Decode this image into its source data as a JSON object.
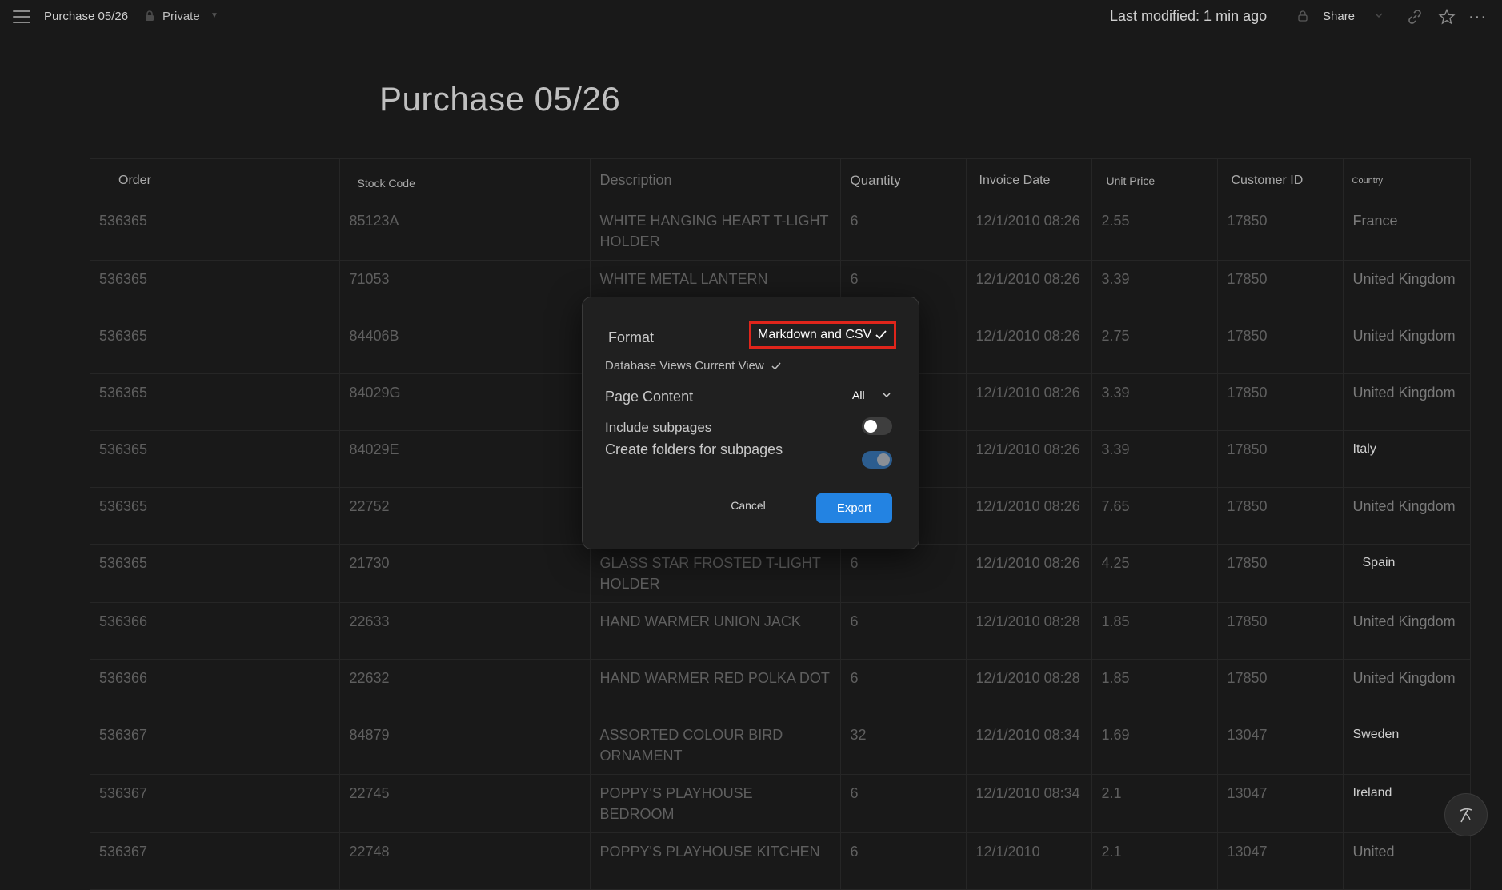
{
  "topbar": {
    "breadcrumb": "Purchase 05/26",
    "privacy": "Private",
    "last_modified": "Last modified: 1 min ago",
    "share_label": "Share"
  },
  "page": {
    "title": "Purchase 05/26"
  },
  "table": {
    "columns": [
      "Order",
      "Stock Code",
      "Description",
      "Quantity",
      "Invoice Date",
      "Unit Price",
      "Customer ID",
      "Country"
    ],
    "rows": [
      [
        "536365",
        "85123A",
        "WHITE HANGING HEART T-LIGHT HOLDER",
        "6",
        "12/1/2010 08:26",
        "2.55",
        "17850",
        "France"
      ],
      [
        "536365",
        "71053",
        "WHITE METAL LANTERN",
        "6",
        "12/1/2010 08:26",
        "3.39",
        "17850",
        "United Kingdom"
      ],
      [
        "536365",
        "84406B",
        "",
        "",
        "12/1/2010 08:26",
        "2.75",
        "17850",
        "United Kingdom"
      ],
      [
        "536365",
        "84029G",
        "",
        "",
        "12/1/2010 08:26",
        "3.39",
        "17850",
        "United Kingdom"
      ],
      [
        "536365",
        "84029E",
        "",
        "",
        "12/1/2010 08:26",
        "3.39",
        "17850",
        "Italy"
      ],
      [
        "536365",
        "22752",
        "",
        "",
        "12/1/2010 08:26",
        "7.65",
        "17850",
        "United Kingdom"
      ],
      [
        "536365",
        "21730",
        "GLASS STAR FROSTED T-LIGHT HOLDER",
        "6",
        "12/1/2010 08:26",
        "4.25",
        "17850",
        "Spain"
      ],
      [
        "536366",
        "22633",
        "HAND WARMER UNION JACK",
        "6",
        "12/1/2010 08:28",
        "1.85",
        "17850",
        "United Kingdom"
      ],
      [
        "536366",
        "22632",
        "HAND WARMER RED POLKA DOT",
        "6",
        "12/1/2010 08:28",
        "1.85",
        "17850",
        "United Kingdom"
      ],
      [
        "536367",
        "84879",
        "ASSORTED COLOUR BIRD ORNAMENT",
        "32",
        "12/1/2010 08:34",
        "1.69",
        "13047",
        "Sweden"
      ],
      [
        "536367",
        "22745",
        "POPPY'S PLAYHOUSE BEDROOM",
        "6",
        "12/1/2010 08:34",
        "2.1",
        "13047",
        "Ireland"
      ],
      [
        "536367",
        "22748",
        "POPPY'S PLAYHOUSE KITCHEN",
        "6",
        "12/1/2010",
        "2.1",
        "13047",
        "United"
      ]
    ],
    "bright_country_rows": [
      4,
      6,
      9,
      10
    ]
  },
  "export_dialog": {
    "format_label": "Format",
    "format_value": "Markdown and CSV",
    "db_views_label": "Database Views Current View",
    "page_content_label": "Page Content",
    "page_content_value": "All",
    "include_subpages_label": "Include subpages",
    "include_subpages_on": false,
    "create_folders_label": "Create folders for subpages",
    "create_folders_on": true,
    "cancel_label": "Cancel",
    "export_label": "Export"
  },
  "colors": {
    "background": "#191919",
    "accent": "#2383e2",
    "highlight_border": "#e0251b"
  }
}
